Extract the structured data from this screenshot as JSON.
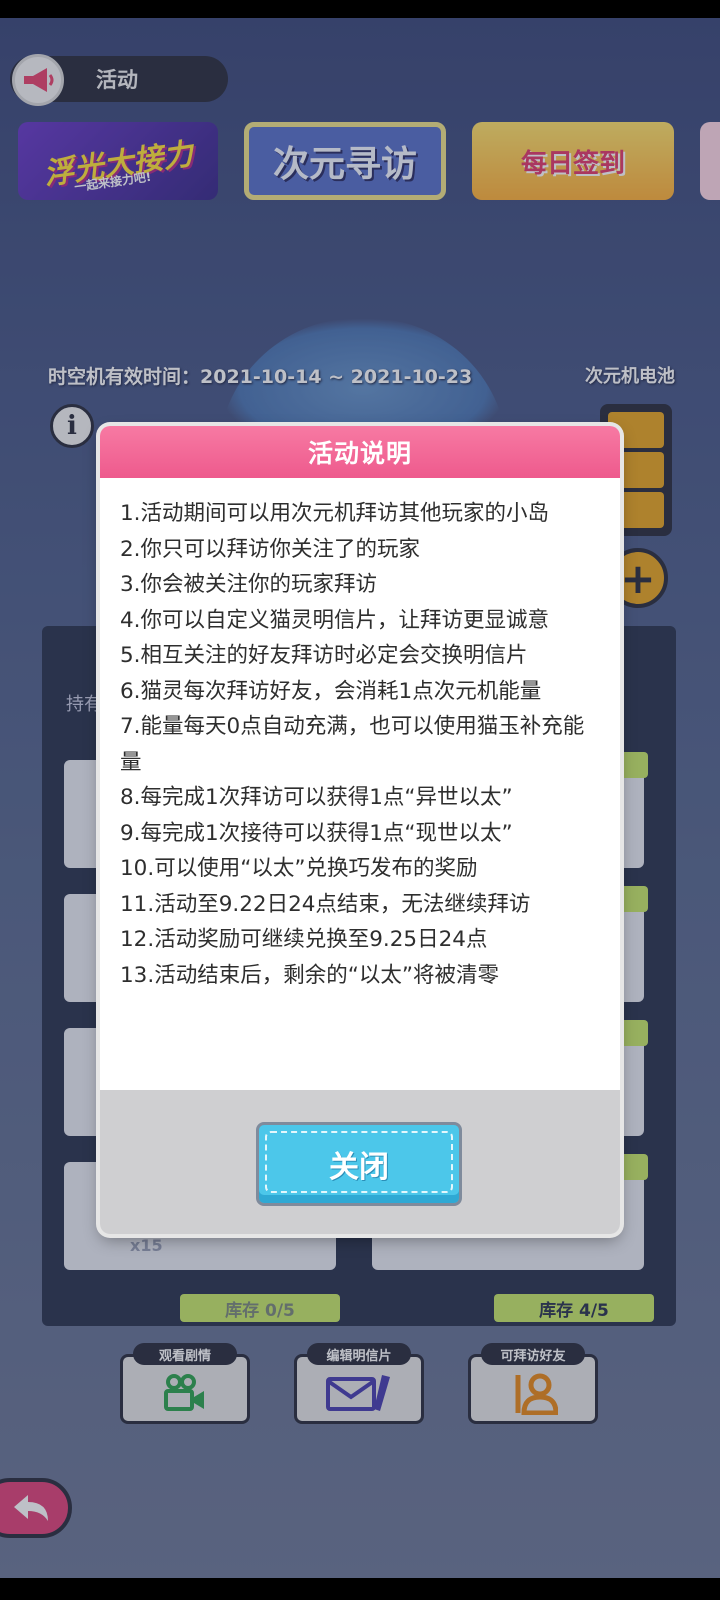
{
  "header": {
    "title": "活动"
  },
  "banners": [
    {
      "main": "浮光大接力",
      "sub": "一起来接力吧!"
    },
    {
      "main": "次元寻访"
    },
    {
      "main": "每日签到"
    }
  ],
  "time": {
    "label": "时空机有效时间：2021-10-14 ~ 2021-10-23"
  },
  "battery": {
    "label": "次元机电池",
    "level": 3,
    "max": 3
  },
  "panel": {
    "label": "持有"
  },
  "stock": {
    "left": "库存 0/5",
    "right": "库存 4/5"
  },
  "qty": "x15",
  "actions": {
    "story": "观看剧情",
    "edit_card": "编辑明信片",
    "visit_friends": "可拜访好友"
  },
  "modal": {
    "title": "活动说明",
    "rules": [
      "1.活动期间可以用次元机拜访其他玩家的小岛",
      "2.你只可以拜访你关注了的玩家",
      "3.你会被关注你的玩家拜访",
      "4.你可以自定义猫灵明信片，让拜访更显诚意",
      "5.相互关注的好友拜访时必定会交换明信片",
      "6.猫灵每次拜访好友，会消耗1点次元机能量",
      "7.能量每天0点自动充满，也可以使用猫玉补充能量",
      "8.每完成1次拜访可以获得1点“异世以太”",
      "9.每完成1次接待可以获得1点“现世以太”",
      "10.可以使用“以太”兑换巧发布的奖励",
      "11.活动至9.22日24点结束，无法继续拜访",
      "12.活动奖励可继续兑换至9.25日24点",
      "13.活动结束后，剩余的“以太”将被清零"
    ],
    "close_label": "关闭"
  },
  "colors": {
    "modal_header": "#ee5a8d",
    "close_button": "#4cc7ea",
    "battery": "#e8a623",
    "stock_tag": "#c8e86a"
  }
}
